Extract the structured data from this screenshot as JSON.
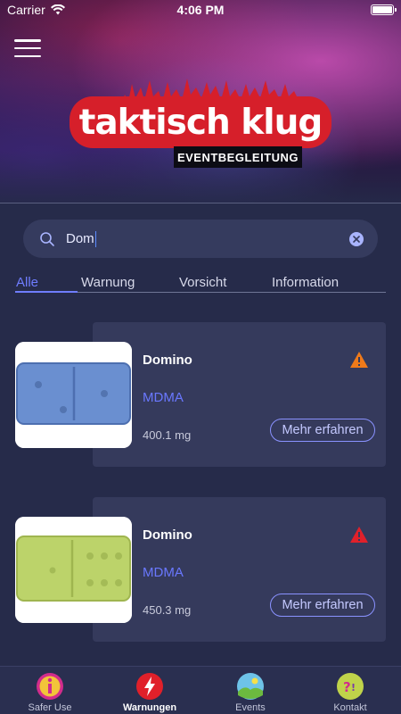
{
  "status": {
    "carrier": "Carrier",
    "time": "4:06 PM",
    "battery_level": 1.0
  },
  "brand": {
    "name": "taktisch klug",
    "tagline": "EVENTBEGLEITUNG"
  },
  "search": {
    "value": "Dom",
    "clear_icon": "clear-circle-icon"
  },
  "filter_tabs": [
    {
      "label": "Alle",
      "active": true
    },
    {
      "label": "Warnung",
      "active": false
    },
    {
      "label": "Vorsicht",
      "active": false
    },
    {
      "label": "Information",
      "active": false
    }
  ],
  "items": [
    {
      "name": "Domino",
      "substance": "MDMA",
      "weight": "400.1 mg",
      "warning_level": "caution",
      "warning_color": "#f07a1a",
      "pill_color": "#6a8fd0",
      "button": "Mehr erfahren"
    },
    {
      "name": "Domino",
      "substance": "MDMA",
      "weight": "450.3 mg",
      "warning_level": "warning",
      "warning_color": "#e0202a",
      "pill_color": "#bcd36a",
      "button": "Mehr erfahren"
    }
  ],
  "tabbar": [
    {
      "label": "Safer Use",
      "icon": "info-icon",
      "active": false
    },
    {
      "label": "Warnungen",
      "icon": "lightning-icon",
      "active": true
    },
    {
      "label": "Events",
      "icon": "landscape-icon",
      "active": false
    },
    {
      "label": "Kontakt",
      "icon": "question-icon",
      "active": false
    }
  ],
  "colors": {
    "background": "#262b4a",
    "card": "#353a5c",
    "accent": "#6a78ff",
    "brand_red": "#d61f2a"
  }
}
